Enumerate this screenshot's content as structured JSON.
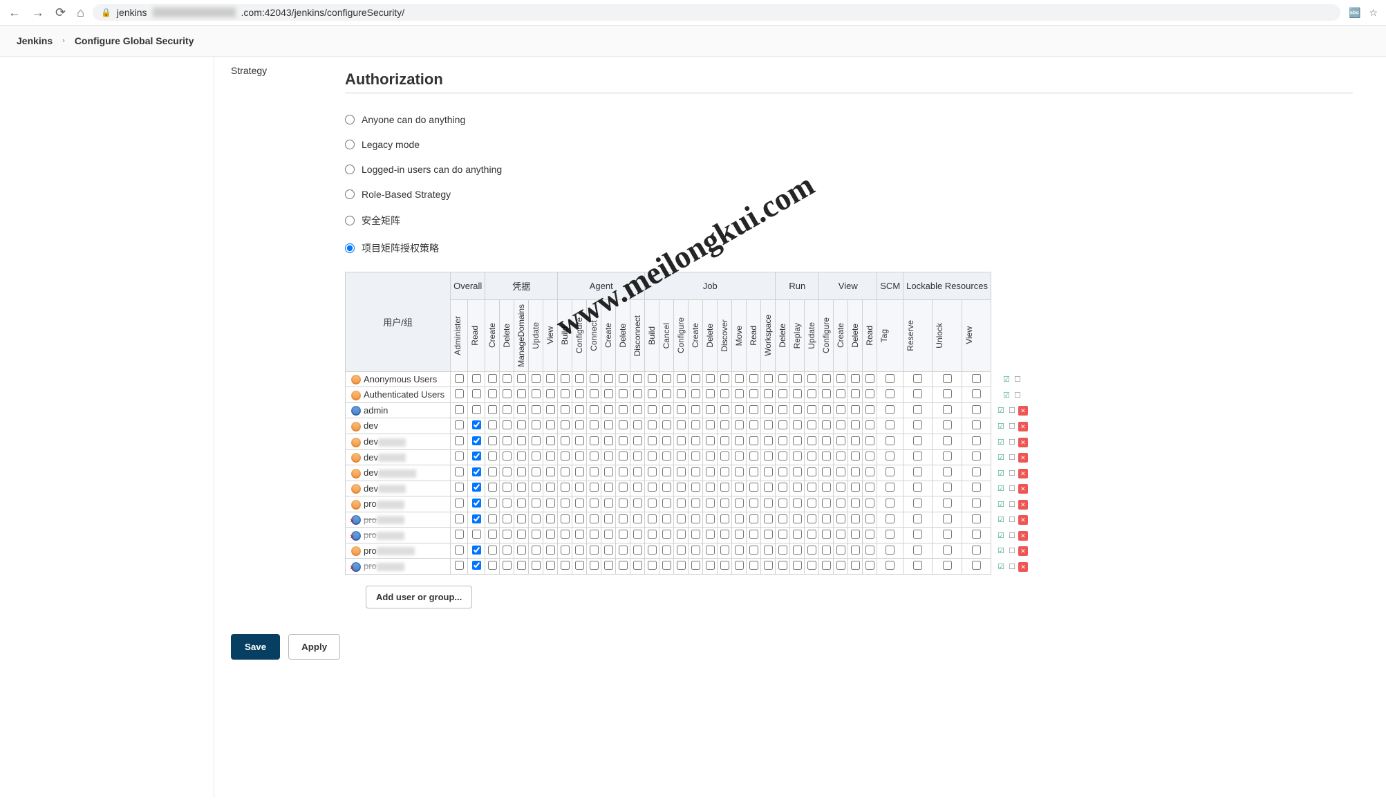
{
  "browser": {
    "url_prefix": "jenkins",
    "url_suffix": ".com:42043/jenkins/configureSecurity/"
  },
  "breadcrumbs": {
    "items": [
      "Jenkins",
      "Configure Global Security"
    ]
  },
  "page": {
    "strategy_label": "Strategy",
    "section_title": "Authorization",
    "radios": [
      {
        "label": "Anyone can do anything",
        "checked": false
      },
      {
        "label": "Legacy mode",
        "checked": false
      },
      {
        "label": "Logged-in users can do anything",
        "checked": false
      },
      {
        "label": "Role-Based Strategy",
        "checked": false
      },
      {
        "label": "安全矩阵",
        "checked": false
      },
      {
        "label": "项目矩阵授权策略",
        "checked": true
      }
    ],
    "user_col_header": "用户/组",
    "groups": [
      {
        "name": "Overall",
        "cols": [
          "Administer",
          "Read"
        ]
      },
      {
        "name": "凭据",
        "cols": [
          "Create",
          "Delete",
          "ManageDomains",
          "Update",
          "View"
        ]
      },
      {
        "name": "Agent",
        "cols": [
          "Build",
          "Configure",
          "Connect",
          "Create",
          "Delete",
          "Disconnect"
        ]
      },
      {
        "name": "Job",
        "cols": [
          "Build",
          "Cancel",
          "Configure",
          "Create",
          "Delete",
          "Discover",
          "Move",
          "Read",
          "Workspace"
        ]
      },
      {
        "name": "Run",
        "cols": [
          "Delete",
          "Replay",
          "Update"
        ]
      },
      {
        "name": "View",
        "cols": [
          "Configure",
          "Create",
          "Delete",
          "Read"
        ]
      },
      {
        "name": "SCM",
        "cols": [
          "Tag"
        ]
      },
      {
        "name": "Lockable Resources",
        "cols": [
          "Reserve",
          "Unlock",
          "View"
        ]
      }
    ],
    "users": [
      {
        "name": "Anonymous Users",
        "type": "group",
        "read_checked": false,
        "removable": false,
        "struck": false,
        "blur": false
      },
      {
        "name": "Authenticated Users",
        "type": "group",
        "read_checked": false,
        "removable": false,
        "struck": false,
        "blur": false
      },
      {
        "name": "admin",
        "type": "single",
        "read_checked": false,
        "removable": true,
        "struck": false,
        "blur": false
      },
      {
        "name": "dev",
        "type": "group",
        "read_checked": true,
        "removable": true,
        "struck": false,
        "blur": false
      },
      {
        "name": "dev",
        "type": "group",
        "read_checked": true,
        "removable": true,
        "struck": false,
        "blur": true
      },
      {
        "name": "dev",
        "type": "group",
        "read_checked": true,
        "removable": true,
        "struck": false,
        "blur": true
      },
      {
        "name": "dev",
        "type": "group",
        "read_checked": true,
        "removable": true,
        "struck": false,
        "blur": "wide"
      },
      {
        "name": "dev",
        "type": "group",
        "read_checked": true,
        "removable": true,
        "struck": false,
        "blur": true
      },
      {
        "name": "pro",
        "type": "group",
        "read_checked": true,
        "removable": true,
        "struck": false,
        "blur": true
      },
      {
        "name": "pro",
        "type": "invalid",
        "read_checked": true,
        "removable": true,
        "struck": true,
        "blur": true
      },
      {
        "name": "pro",
        "type": "invalid",
        "read_checked": false,
        "removable": true,
        "struck": true,
        "blur": true
      },
      {
        "name": "pro",
        "type": "group",
        "read_checked": true,
        "removable": true,
        "struck": false,
        "blur": "wide"
      },
      {
        "name": "pro",
        "type": "invalid",
        "read_checked": true,
        "removable": true,
        "struck": true,
        "blur": true
      }
    ],
    "add_button": "Add user or group...",
    "save_label": "Save",
    "apply_label": "Apply",
    "watermark": "www.meilongkui.com"
  }
}
